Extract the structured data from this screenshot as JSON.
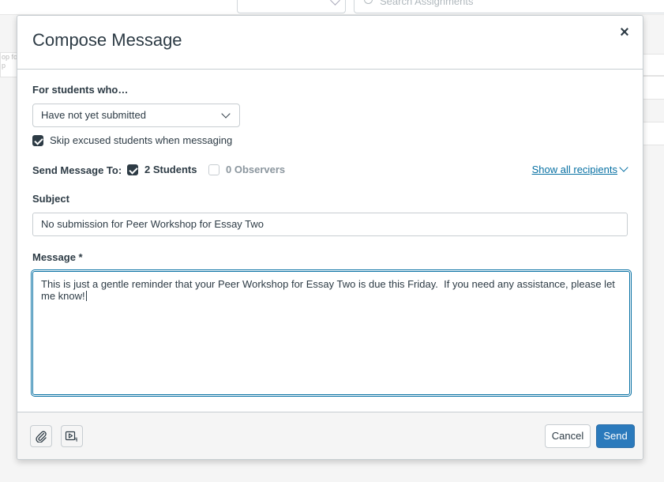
{
  "background": {
    "search_placeholder": "Search Assignments",
    "left_snippet": "op fo\np"
  },
  "modal": {
    "title": "Compose Message",
    "close_label": "×",
    "filter": {
      "label": "For students who…",
      "selected": "Have not yet submitted"
    },
    "skip_excused": {
      "label": "Skip excused students when messaging",
      "checked": true
    },
    "recipients": {
      "label": "Send Message To:",
      "students_label": "2 Students",
      "students_checked": true,
      "observers_label": "0 Observers",
      "observers_checked": false,
      "show_all_label": "Show all recipients"
    },
    "subject": {
      "label": "Subject",
      "value": "No submission for Peer Workshop for Essay Two"
    },
    "message": {
      "label": "Message *",
      "value": "This is just a gentle reminder that your Peer Workshop for Essay Two is due this Friday.  If you need any assistance, please let me know!"
    },
    "footer": {
      "attach_icon": "paperclip-icon",
      "media_icon": "media-record-icon",
      "cancel_label": "Cancel",
      "send_label": "Send"
    }
  },
  "colors": {
    "primary": "#2b7abc",
    "link": "#0770a3",
    "text": "#2d3b45",
    "border": "#c7cdd1"
  }
}
